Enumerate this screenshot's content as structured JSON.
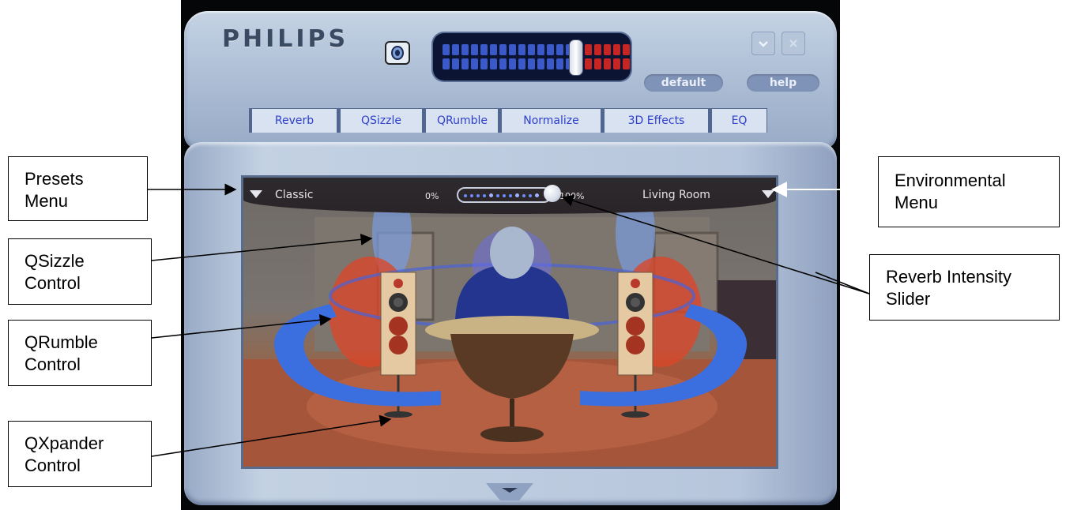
{
  "window": {
    "brand": "PHILIPS",
    "default_label": "default",
    "help_label": "help",
    "volume": {
      "level_fraction": 0.72
    }
  },
  "tabs": [
    "Reverb",
    "QSizzle",
    "QRumble",
    "Normalize",
    "3D Effects",
    "EQ"
  ],
  "scene": {
    "preset_value": "Classic",
    "environment_value": "Living Room",
    "reverb_min_label": "0%",
    "reverb_max_label": "100%",
    "reverb_intensity_fraction": 1.0
  },
  "callouts": {
    "presets": [
      "Presets",
      "Menu"
    ],
    "qsizzle": [
      "QSizzle",
      "Control"
    ],
    "qrumble": [
      "QRumble",
      "Control"
    ],
    "qxpander": [
      "QXpander",
      "Control"
    ],
    "environmental": [
      "Environmental",
      "Menu"
    ],
    "reverb": [
      "Reverb Intensity",
      "Slider"
    ]
  },
  "colors": {
    "accent_blue": "#3b6fe0",
    "rumble_red": "#d9472a",
    "frame": "#aebfd6"
  },
  "icons": {
    "mute": "speaker-icon",
    "minimize": "minimize-icon",
    "close": "close-icon"
  }
}
